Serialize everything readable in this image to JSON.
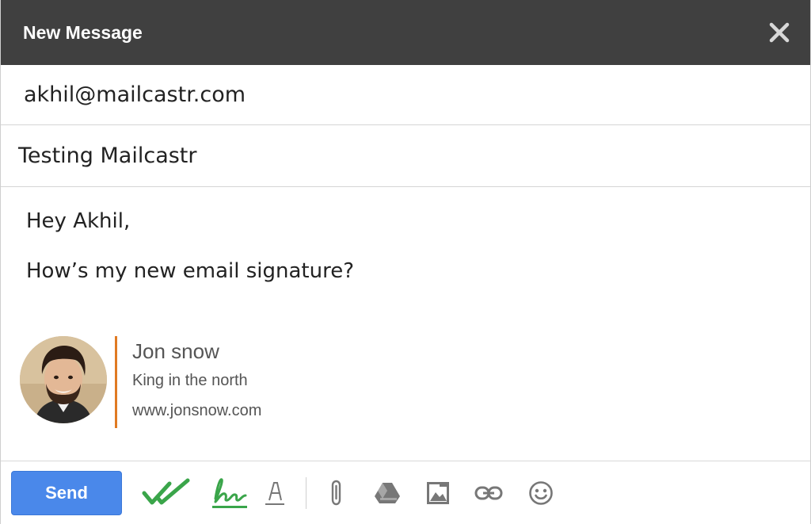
{
  "window": {
    "title": "New Message"
  },
  "compose": {
    "to": "akhil@mailcastr.com",
    "subject": "Testing Mailcastr",
    "body_lines": [
      "Hey Akhil,",
      "How’s my new email signature?"
    ]
  },
  "signature": {
    "name": "Jon snow",
    "role": "King in the north",
    "website": "www.jonsnow.com",
    "divider_color": "#e07a22"
  },
  "toolbar": {
    "send_label": "Send",
    "icons": [
      "double-check-icon",
      "signature-icon",
      "text-format-icon",
      "attach-icon",
      "drive-icon",
      "insert-photo-icon",
      "link-icon",
      "emoji-icon"
    ]
  },
  "colors": {
    "titlebar": "#404040",
    "send": "#4a88ea",
    "check": "#3aa54a"
  }
}
